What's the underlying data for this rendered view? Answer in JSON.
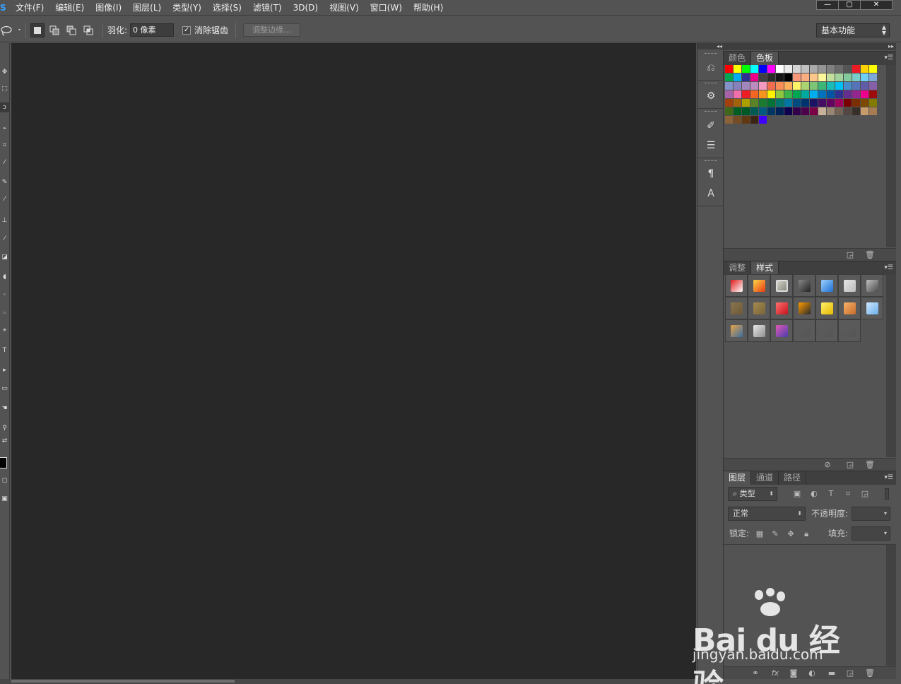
{
  "menubar": {
    "logo": "S",
    "items": [
      "文件(F)",
      "编辑(E)",
      "图像(I)",
      "图层(L)",
      "类型(Y)",
      "选择(S)",
      "滤镜(T)",
      "3D(D)",
      "视图(V)",
      "窗口(W)",
      "帮助(H)"
    ],
    "minimize": "—",
    "restore": "▢",
    "close": "✕"
  },
  "options": {
    "feather_label": "羽化:",
    "feather_value": "0 像素",
    "antialias_label": "消除锯齿",
    "antialias_checked": true,
    "refine_edge": "调整边缘...",
    "workspace": "基本功能"
  },
  "panels": {
    "color_tabs": [
      "颜色",
      "色板"
    ],
    "adjust_tabs": [
      "调整",
      "样式"
    ],
    "layers_tabs": [
      "图层",
      "通道",
      "路径"
    ],
    "layers": {
      "filter_kind": "类型",
      "blend_mode": "正常",
      "opacity_label": "不透明度:",
      "lock_label": "锁定:",
      "fill_label": "填充:"
    }
  },
  "swatches": [
    "#ff0000",
    "#ffff00",
    "#00ff00",
    "#00ffff",
    "#0000ff",
    "#ff00ff",
    "#ffffff",
    "#ebebeb",
    "#d5d5d5",
    "#c0c0c0",
    "#aaaaaa",
    "#959595",
    "#808080",
    "#6b6b6b",
    "#555555",
    "#ed1c24",
    "#ffd200",
    "#ffff00",
    "#00a651",
    "#00aeef",
    "#2e3192",
    "#ec008c",
    "#404040",
    "#2b2b2b",
    "#161616",
    "#000000",
    "#f7977a",
    "#fbad82",
    "#fdc68a",
    "#fff799",
    "#c4df9b",
    "#a3d39c",
    "#82ca9c",
    "#7accc8",
    "#6dcff6",
    "#7da7d9",
    "#8393ca",
    "#8781bd",
    "#a187be",
    "#bd8cbf",
    "#f49ac2",
    "#f26c4f",
    "#f68e55",
    "#fbaf5c",
    "#fff467",
    "#acd372",
    "#7cc576",
    "#3bb878",
    "#1abbb4",
    "#00bff3",
    "#448ccb",
    "#5574b9",
    "#605ca8",
    "#855fa8",
    "#a763a8",
    "#f06ea9",
    "#ed1c24",
    "#f26522",
    "#f7941d",
    "#fff200",
    "#8dc63f",
    "#39b54a",
    "#00a651",
    "#00a99d",
    "#00aeef",
    "#0072bc",
    "#0054a6",
    "#2e3192",
    "#662d91",
    "#92278f",
    "#ec008c",
    "#9e0b0f",
    "#a0410d",
    "#a3620a",
    "#aba000",
    "#598527",
    "#1a7b30",
    "#007236",
    "#00746b",
    "#0076a3",
    "#004b80",
    "#003471",
    "#1b1464",
    "#440e62",
    "#630460",
    "#9e005d",
    "#790000",
    "#7b2e00",
    "#7d4900",
    "#827b00",
    "#406618",
    "#005e20",
    "#005826",
    "#005952",
    "#005b7f",
    "#003663",
    "#002157",
    "#0d004c",
    "#32004b",
    "#4b0049",
    "#7b0046",
    "#c7b299",
    "#998675",
    "#736357",
    "#534741",
    "#37302a",
    "#c69c6d",
    "#a67c52",
    "#8c6239",
    "#754c24",
    "#603913",
    "#3c2415",
    "#3f00ff"
  ],
  "styles": [
    {
      "color": "#ffffff",
      "accent": "#e01a1a",
      "selected": false
    },
    {
      "color": "#e73a10",
      "accent": "#ffd54a",
      "selected": false
    },
    {
      "color": "#8a8a80",
      "accent": "#cfcfc4",
      "selected": true
    },
    {
      "color": "#222222",
      "accent": "#888888",
      "selected": false
    },
    {
      "color": "#1f6fd1",
      "accent": "#9bd0ff",
      "selected": false
    },
    {
      "color": "#bdbdbd",
      "accent": "#e5e5e5",
      "selected": false
    },
    {
      "color": "#4a4a4a",
      "accent": "#c0c0c0",
      "selected": false
    },
    {
      "color": "#6d5a3a",
      "accent": "#8b744d",
      "selected": false
    },
    {
      "color": "#7a6539",
      "accent": "#a58b4f",
      "selected": false
    },
    {
      "color": "#c4121b",
      "accent": "#ff6f6f",
      "selected": false
    },
    {
      "color": "#2a2a2a",
      "accent": "#ff9a00",
      "selected": false
    },
    {
      "color": "#e3b800",
      "accent": "#fff06a",
      "selected": false
    },
    {
      "color": "#c76a2b",
      "accent": "#f7b36a",
      "selected": false
    },
    {
      "color": "#6aaeea",
      "accent": "#cfe9ff",
      "selected": false
    },
    {
      "color": "#3b6fa0",
      "accent": "#e7a24a",
      "selected": false
    },
    {
      "color": "#8f8f8f",
      "accent": "#e8e8e8",
      "selected": false
    },
    {
      "color": "#4b3ab0",
      "accent": "#e05bb3",
      "selected": false
    },
    {
      "color": "#555555",
      "accent": "#5d5d5d",
      "selected": false
    },
    {
      "color": "#555555",
      "accent": "#5d5d5d",
      "selected": false
    },
    {
      "color": "#555555",
      "accent": "#5d5d5d",
      "selected": false
    }
  ],
  "watermark": {
    "brand": "Bai du 经验",
    "url": "jingyan.baidu.com"
  }
}
